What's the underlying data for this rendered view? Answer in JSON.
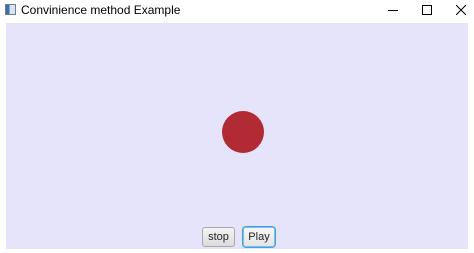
{
  "window": {
    "title": "Convinience method Example",
    "icons": {
      "app": "app-window-icon",
      "minimize": "minimize-icon",
      "maximize": "maximize-icon",
      "close": "close-icon"
    }
  },
  "stage": {
    "background_color": "#e5e4fa",
    "ball_color": "#b22a34",
    "buttons": {
      "stop_label": "stop",
      "play_label": "Play"
    }
  }
}
